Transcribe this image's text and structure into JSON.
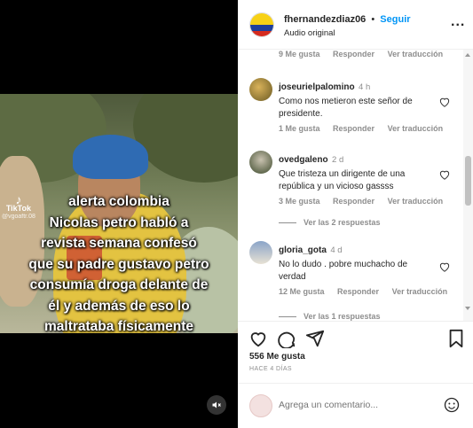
{
  "header": {
    "username": "fhernandezdiaz06",
    "separator": "•",
    "follow_label": "Seguir",
    "audio_label": "Audio original",
    "more_label": "..."
  },
  "media": {
    "caption_lines": [
      "alerta colombia",
      "Nicolas petro habló a",
      "revista semana confesó",
      "que su padre gustavo petro",
      "consumía droga delante de",
      "él y además de eso lo",
      "maltrataba físicamente"
    ],
    "tiktok_label": "TikTok",
    "tiktok_handle": "@vgoaftr.08",
    "volume_icon": "volume-muted-icon"
  },
  "comments": {
    "top_meta": {
      "likes": "9 Me gusta",
      "reply": "Responder",
      "translate": "Ver traducción"
    },
    "items": [
      {
        "user": "joseurielpalomino",
        "time": "4 h",
        "text": [
          "Como nos metieron este señor de",
          "presidente."
        ],
        "likes": "1 Me gusta",
        "reply": "Responder",
        "translate": "Ver traducción"
      },
      {
        "user": "ovedgaleno",
        "time": "2 d",
        "text": [
          "Que tristeza un dirigente de una",
          "república y un vicioso gassss"
        ],
        "likes": "3 Me gusta",
        "reply": "Responder",
        "translate": "Ver traducción",
        "replies": "Ver las 2 respuestas"
      },
      {
        "user": "gloria_gota",
        "time": "4 d",
        "text": [
          "No lo dudo . pobre muchacho de",
          "verdad"
        ],
        "likes": "12 Me gusta",
        "reply": "Responder",
        "translate": "Ver traducción",
        "replies": "Ver las 1 respuestas"
      }
    ]
  },
  "actions": {
    "likes": "556 Me gusta",
    "ago": "HACE 4 DÍAS"
  },
  "add_comment": {
    "placeholder": "Agrega un comentario..."
  },
  "colors": {
    "accent": "#0095f6",
    "muted": "#8e8e8e",
    "text": "#262626"
  }
}
